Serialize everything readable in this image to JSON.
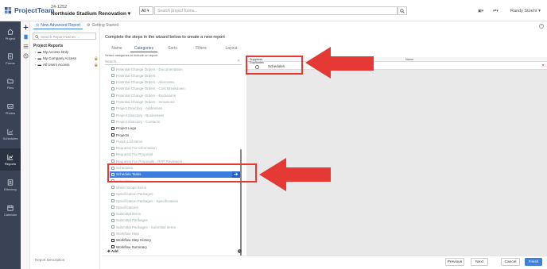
{
  "header": {
    "logo_text": "ProjectTeam",
    "project_number": "24-1252",
    "project_name": "Northside Stadium Renovation",
    "scope_select": "All",
    "search_placeholder": "Search project forms...",
    "user_name": "Randy Stoehr"
  },
  "nav": {
    "items": [
      {
        "label": "Project",
        "icon": "home-icon"
      },
      {
        "label": "Forms",
        "icon": "forms-icon"
      },
      {
        "label": "Files",
        "icon": "folder-icon"
      },
      {
        "label": "Photos",
        "icon": "photo-icon"
      },
      {
        "label": "Schedules",
        "icon": "schedule-icon"
      },
      {
        "label": "Reports",
        "icon": "reports-icon"
      },
      {
        "label": "Directory",
        "icon": "directory-icon"
      },
      {
        "label": "Calendar",
        "icon": "calendar-icon"
      }
    ]
  },
  "tabs": [
    {
      "label": "New Advanced Report"
    },
    {
      "label": "Getting Started"
    }
  ],
  "tree": {
    "search_placeholder": "Search Report Names ...",
    "title": "Project Reports",
    "items": [
      {
        "label": "My Access Only"
      },
      {
        "label": "My Company Access"
      },
      {
        "label": "All Users Access"
      }
    ],
    "description_label": "Report Description"
  },
  "wizard": {
    "title": "Complete the steps in the wizard below to create a new report",
    "steps": [
      "Name",
      "Categories",
      "Sorts",
      "Filters",
      "Layout"
    ],
    "hint": "Select categories to include on report",
    "search_placeholder": "Search...",
    "categories": [
      {
        "label": "Potential Change Orders - Documentation",
        "style": "faded"
      },
      {
        "label": "Potential Change Orders",
        "style": "faded"
      },
      {
        "label": "Potential Change Orders - Alternates",
        "style": "faded"
      },
      {
        "label": "Potential Change Orders - Cost Breakdown",
        "style": "faded"
      },
      {
        "label": "Potential Change Orders - Exclusions",
        "style": "faded"
      },
      {
        "label": "Potential Change Orders - Inclusions",
        "style": "faded"
      },
      {
        "label": "Project Directory - Addresses",
        "style": "faded"
      },
      {
        "label": "Project Directory - Businesses",
        "style": "faded"
      },
      {
        "label": "Project Directory - Contacts",
        "style": "faded"
      },
      {
        "label": "Project Logo",
        "style": "normal"
      },
      {
        "label": "Projects",
        "style": "normal"
      },
      {
        "label": "Punch List Items",
        "style": "faded"
      },
      {
        "label": "Requests For Information",
        "style": "faded"
      },
      {
        "label": "Requests For Proposal",
        "style": "faded"
      },
      {
        "label": "Requests For Proposals - RFP Reviewers",
        "style": "faded"
      },
      {
        "label": "Schedules",
        "style": "faded"
      },
      {
        "label": "Schedule Tasks",
        "style": "selected"
      },
      {
        "label": "Schedules",
        "style": "faded"
      },
      {
        "label": "Sheet Scope Items",
        "style": "faded"
      },
      {
        "label": "Specification Packages",
        "style": "faded"
      },
      {
        "label": "Specification Packages - Specifications",
        "style": "faded"
      },
      {
        "label": "Specifications",
        "style": "faded"
      },
      {
        "label": "Submittal Items",
        "style": "faded"
      },
      {
        "label": "Submittal Packages",
        "style": "faded"
      },
      {
        "label": "Submittal Packages - Submittal Items",
        "style": "faded"
      },
      {
        "label": "Workflow Step",
        "style": "faded"
      },
      {
        "label": "Workflow Step History",
        "style": "normal"
      },
      {
        "label": "Workflow Summary",
        "style": "normal"
      }
    ],
    "add_label": "Add",
    "selected": {
      "col_suppress": "Suppress",
      "col_duplicates": "Duplicates",
      "col_name": "Name",
      "rows": [
        {
          "category": "Schedules"
        }
      ]
    }
  },
  "footer": {
    "previous": "Previous",
    "next": "Next",
    "cancel": "Cancel",
    "finish": "Finish"
  },
  "colors": {
    "nav_bg": "#3a4355",
    "accent": "#3b82d8",
    "selected_row": "#3b7ddd",
    "annotation_red": "#e53935"
  }
}
